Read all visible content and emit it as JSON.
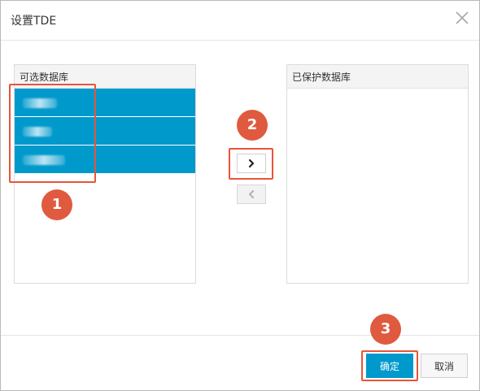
{
  "dialog": {
    "title": "设置TDE",
    "close_icon": "close-icon"
  },
  "left_panel": {
    "header": "可选数据库",
    "items": [
      {
        "label": "",
        "selected": true
      },
      {
        "label": "",
        "selected": true
      },
      {
        "label": "",
        "selected": true
      }
    ]
  },
  "right_panel": {
    "header": "已保护数据库",
    "items": []
  },
  "transfer": {
    "move_right_icon": "chevron-right-icon",
    "move_left_icon": "chevron-left-icon"
  },
  "footer": {
    "confirm_label": "确定",
    "cancel_label": "取消"
  },
  "callouts": [
    "1",
    "2",
    "3"
  ],
  "colors": {
    "accent": "#0099cc",
    "callout": "#df5a3f",
    "highlight_border": "#e8553a"
  }
}
